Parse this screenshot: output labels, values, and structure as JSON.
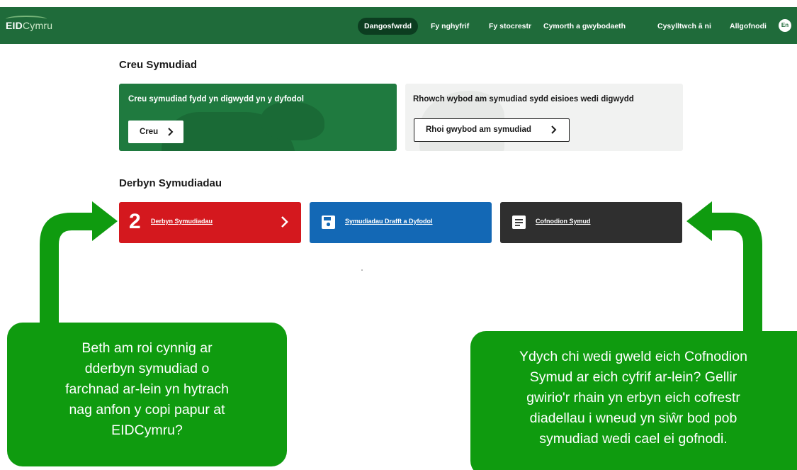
{
  "header": {
    "logo_bold": "EID",
    "logo_light": "Cymru",
    "nav": [
      {
        "label": "Dangosfwrdd",
        "active": true
      },
      {
        "label": "Fy nghyfrif",
        "active": false
      },
      {
        "label": "Fy stocrestr",
        "active": false
      },
      {
        "label": "Cymorth a gwybodaeth",
        "active": false
      },
      {
        "label": "Cysylltwch â ni",
        "active": false
      },
      {
        "label": "Allgofnodi",
        "active": false
      }
    ],
    "language_button": "En"
  },
  "create_section": {
    "title": "Creu Symudiad",
    "future_card": {
      "text": "Creu symudiad fydd yn digwydd yn y dyfodol",
      "button": "Creu"
    },
    "past_card": {
      "text": "Rhowch wybod am symudiad sydd eisioes wedi digwydd",
      "button": "Rhoi gwybod am symudiad"
    }
  },
  "receive_section": {
    "title": "Derbyn Symudiadau",
    "tiles": [
      {
        "count": "2",
        "label": "Derbyn Symudiadau",
        "color": "#d4181e"
      },
      {
        "label": "Symudiadau Drafft a Dyfodol",
        "icon": "save-icon",
        "color": "#1368b5"
      },
      {
        "label": "Cofnodion Symud",
        "icon": "document-icon",
        "color": "#2f2f2f"
      }
    ]
  },
  "callouts": {
    "left": [
      "Beth am roi cynnig ar",
      "dderbyn symudiad o",
      "farchnad ar-lein yn hytrach",
      "nag anfon y copi papur at",
      "EIDCymru?"
    ],
    "right": [
      "Ydych chi wedi gweld eich Cofnodion",
      "Symud ar eich cyfrif ar-lein? Gellir",
      "gwirio'r rhain yn erbyn eich cofrestr",
      "diadellau i wneud yn siŵr bod pob",
      "symudiad wedi cael ei gofnodi."
    ]
  },
  "colors": {
    "header_green": "#1f6b3a",
    "callout_green": "#0f9b0f",
    "receive_red": "#d4181e",
    "draft_blue": "#1368b5",
    "records_dark": "#2f2f2f"
  }
}
